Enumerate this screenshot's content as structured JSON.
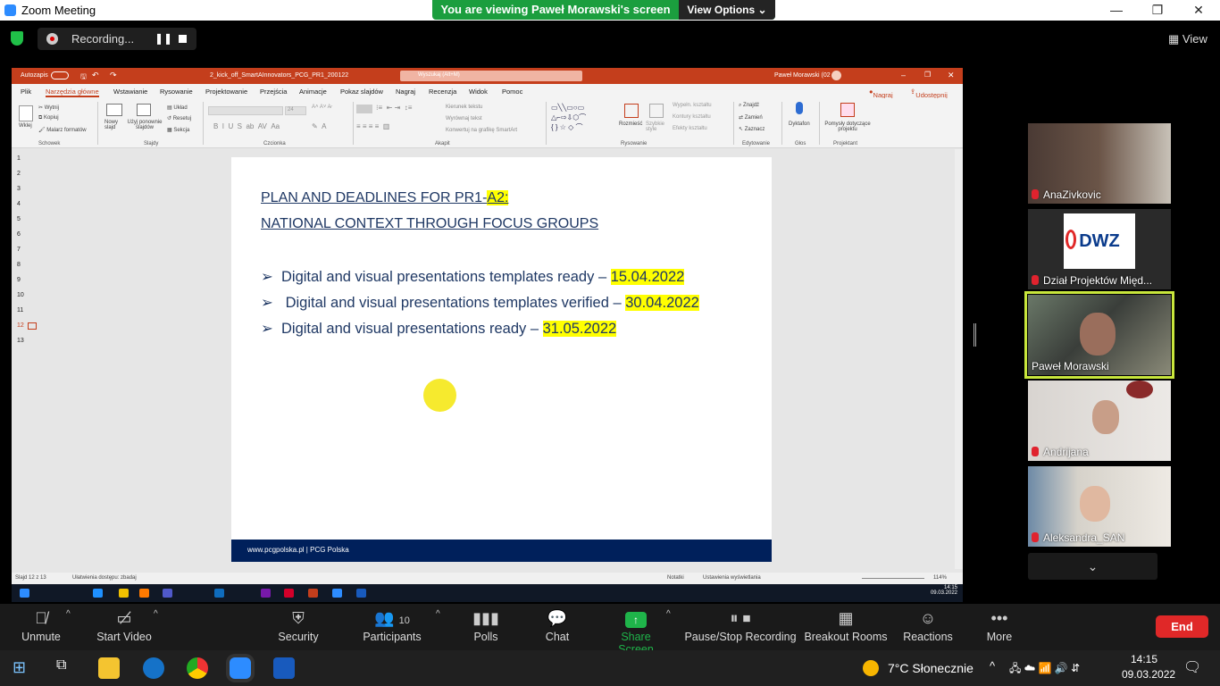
{
  "window": {
    "title": "Zoom Meeting"
  },
  "banner": {
    "viewing": "You are viewing Paweł Morawski's screen",
    "options": "View Options"
  },
  "recording": {
    "label": "Recording..."
  },
  "view": {
    "label": "View"
  },
  "ppt": {
    "autosave": "Autozapis",
    "filename": "2_kick_off_SmartAInnovators_PCG_PR1_200122",
    "search": "Wyszukaj (Alt+M)",
    "user": "Paweł Morawski (02",
    "tabs": [
      "Plik",
      "Narzędzia główne",
      "Wstawianie",
      "Rysowanie",
      "Projektowanie",
      "Przejścia",
      "Animacje",
      "Pokaz slajdów",
      "Nagraj",
      "Recenzja",
      "Widok",
      "Pomoc"
    ],
    "record_btn": "Nagraj",
    "share_btn": "Udostępnij",
    "groups": [
      "Schowek",
      "Slajdy",
      "Czcionka",
      "Akapit",
      "Rysowanie",
      "Edytowanie",
      "Głos",
      "Projektant"
    ],
    "ribbon": {
      "paste": "Wklej",
      "cut": "Wytnij",
      "copy": "Kopiuj",
      "painter": "Malarz formatów",
      "new_slide": "Nowy slajd",
      "reuse": "Użyj ponownie slajdów",
      "layout": "Układ",
      "reset": "Resetuj",
      "section": "Sekcja",
      "font_size": "24",
      "text_dir": "Kierunek tekstu",
      "align_text": "Wyrównaj tekst",
      "smartart": "Konwertuj na grafikę SmartArt",
      "arrange": "Rozmieść",
      "quick_styles": "Szybkie style",
      "shape_fill": "Wypełn. kształtu",
      "shape_outline": "Kontury kształtu",
      "shape_effects": "Efekty kształtu",
      "find": "Znajdź",
      "replace": "Zamień",
      "select": "Zaznacz",
      "dictate": "Dyktafon",
      "designer": "Pomysły dotyczące projektu"
    },
    "thumbs": [
      "1",
      "2",
      "3",
      "4",
      "5",
      "6",
      "7",
      "8",
      "9",
      "10",
      "11",
      "12",
      "13"
    ],
    "slide": {
      "title1_a": "PLAN AND DEADLINES FOR PR1-",
      "title1_b": "A2:",
      "title2": "NATIONAL CONTEXT THROUGH FOCUS GROUPS",
      "bullets": [
        {
          "text": "Digital and visual presentations templates ready –",
          "date": "15.04.2022"
        },
        {
          "text": "Digital and visual presentations templates verified –",
          "date": "30.04.2022"
        },
        {
          "text": "Digital and visual presentations ready –",
          "date": "31.05.2022"
        }
      ],
      "bullet_glyph": "➢",
      "footer": "www.pcgpolska.pl | PCG Polska"
    },
    "status": {
      "slide": "Slajd 12 z 13",
      "access": "Ułatwienia dostępu: zbadaj",
      "notes": "Notatki",
      "display": "Ustawienia wyświetlania",
      "zoom": "114%"
    },
    "inner_clock": {
      "time": "14:15",
      "date": "09.03.2022"
    }
  },
  "participants_gallery": [
    {
      "name": "AnaZivkovic",
      "muted": true
    },
    {
      "name": "Dział Projektów Międ...",
      "muted": true,
      "logo": "DWZ"
    },
    {
      "name": "Paweł Morawski",
      "muted": false,
      "active": true
    },
    {
      "name": "Andrijana",
      "muted": true
    },
    {
      "name": "Aleksandra_SAN",
      "muted": true
    }
  ],
  "toolbar": {
    "unmute": "Unmute",
    "start_video": "Start Video",
    "security": "Security",
    "participants": "Participants",
    "participants_count": "10",
    "polls": "Polls",
    "chat": "Chat",
    "share_screen": "Share Screen",
    "pause_stop": "Pause/Stop Recording",
    "breakout": "Breakout Rooms",
    "reactions": "Reactions",
    "more": "More",
    "end": "End"
  },
  "taskbar": {
    "weather": "7°C Słonecznie",
    "time": "14:15",
    "date": "09.03.2022"
  },
  "colors": {
    "zoom_blue": "#2d8cff",
    "viewing_green": "#1b9e3e",
    "ppt_red": "#c43e1c",
    "slide_title": "#1f3864",
    "highlight": "#ffff00",
    "footer": "#00205b",
    "end_red": "#e02828",
    "speaker": "#c8e63c"
  }
}
